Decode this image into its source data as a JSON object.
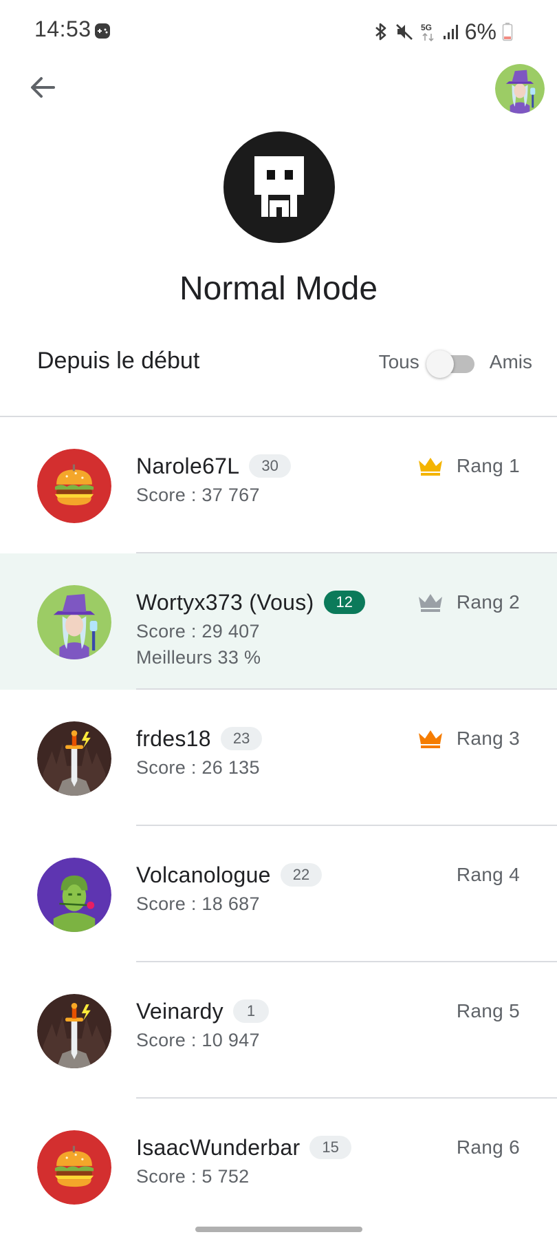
{
  "status_bar": {
    "time": "14:53",
    "network": "5G",
    "battery_percent": "6%",
    "icons": [
      "game-controller-icon",
      "bluetooth-icon",
      "mute-icon",
      "network-5g-icon",
      "signal-icon",
      "battery-low-icon"
    ]
  },
  "header": {
    "back_icon": "arrow-back-icon",
    "game_title": "Normal Mode"
  },
  "filter": {
    "period": "Depuis le début",
    "left_label": "Tous",
    "right_label": "Amis",
    "toggle_on": false
  },
  "leaderboard": [
    {
      "name": "Narole67L",
      "level": "30",
      "score": "Score : 37 767",
      "extra": "",
      "rank": "Rang 1",
      "crown": "gold",
      "avatar": "burger",
      "is_me": false
    },
    {
      "name": "Wortyx373 (Vous)",
      "level": "12",
      "score": "Score : 29 407",
      "extra": "Meilleurs 33 %",
      "rank": "Rang 2",
      "crown": "silver",
      "avatar": "witch",
      "is_me": true
    },
    {
      "name": "frdes18",
      "level": "23",
      "score": "Score : 26 135",
      "extra": "",
      "rank": "Rang 3",
      "crown": "bronze",
      "avatar": "sword",
      "is_me": false
    },
    {
      "name": "Volcanologue",
      "level": "22",
      "score": "Score : 18 687",
      "extra": "",
      "rank": "Rang 4",
      "crown": "",
      "avatar": "soldier",
      "is_me": false
    },
    {
      "name": "Veinardy",
      "level": "1",
      "score": "Score : 10 947",
      "extra": "",
      "rank": "Rang 5",
      "crown": "",
      "avatar": "sword",
      "is_me": false
    },
    {
      "name": "IsaacWunderbar",
      "level": "15",
      "score": "Score : 5 752",
      "extra": "",
      "rank": "Rang 6",
      "crown": "",
      "avatar": "burger",
      "is_me": false
    }
  ],
  "colors": {
    "accent": "#0b7a5a",
    "highlight_row": "#eef6f3",
    "crown_gold": "#f4b400",
    "crown_silver": "#9aa0a6",
    "crown_bronze": "#f57c00"
  }
}
